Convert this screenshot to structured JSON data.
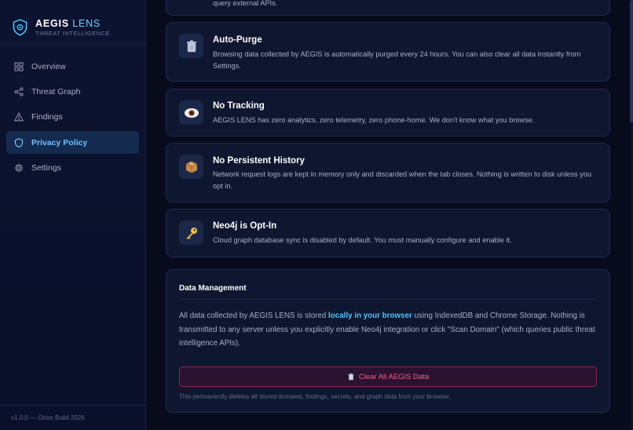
{
  "app": {
    "brand_name": "AEGIS",
    "brand_accent": "LENS",
    "brand_sub": "THREAT INTELLIGENCE",
    "version": "v1.0.0 — Orion Build 2026"
  },
  "sidebar": {
    "items": [
      {
        "label": "Overview",
        "icon": "grid-icon"
      },
      {
        "label": "Threat Graph",
        "icon": "share-nodes-icon"
      },
      {
        "label": "Findings",
        "icon": "warning-triangle-icon"
      },
      {
        "label": "Privacy Policy",
        "icon": "shield-icon",
        "active": true
      },
      {
        "label": "Settings",
        "icon": "gear-icon"
      }
    ]
  },
  "cards": [
    {
      "title": "",
      "desc": "query external APIs."
    },
    {
      "title": "Auto-Purge",
      "icon": "trash-icon",
      "desc": "Browsing data collected by AEGIS is automatically purged every 24 hours. You can also clear all data instantly from Settings."
    },
    {
      "title": "No Tracking",
      "icon": "eye-icon",
      "desc": "AEGIS LENS has zero analytics, zero telemetry, zero phone-home. We don't know what you browse."
    },
    {
      "title": "No Persistent History",
      "icon": "package-icon",
      "desc": "Network request logs are kept in memory only and discarded when the tab closes. Nothing is written to disk unless you opt in."
    },
    {
      "title": "Neo4j is Opt-In",
      "icon": "key-icon",
      "desc": "Cloud graph database sync is disabled by default. You must manually configure and enable it."
    }
  ],
  "data_management": {
    "title": "Data Management",
    "text_before": "All data collected by AEGIS LENS is stored ",
    "text_highlight": "locally in your browser",
    "text_after": " using IndexedDB and Chrome Storage. Nothing is transmitted to any server unless you explicitly enable Neo4j integration or click \"Scan Domain\" (which queries public threat intelligence APIs).",
    "button_label": "Clear All AEGIS Data",
    "note": "This permanently deletes all stored domains, findings, secrets, and graph data from your browser."
  },
  "colors": {
    "background": "#070b1c",
    "accent": "#4fc3ff",
    "danger": "#ff5a86"
  }
}
